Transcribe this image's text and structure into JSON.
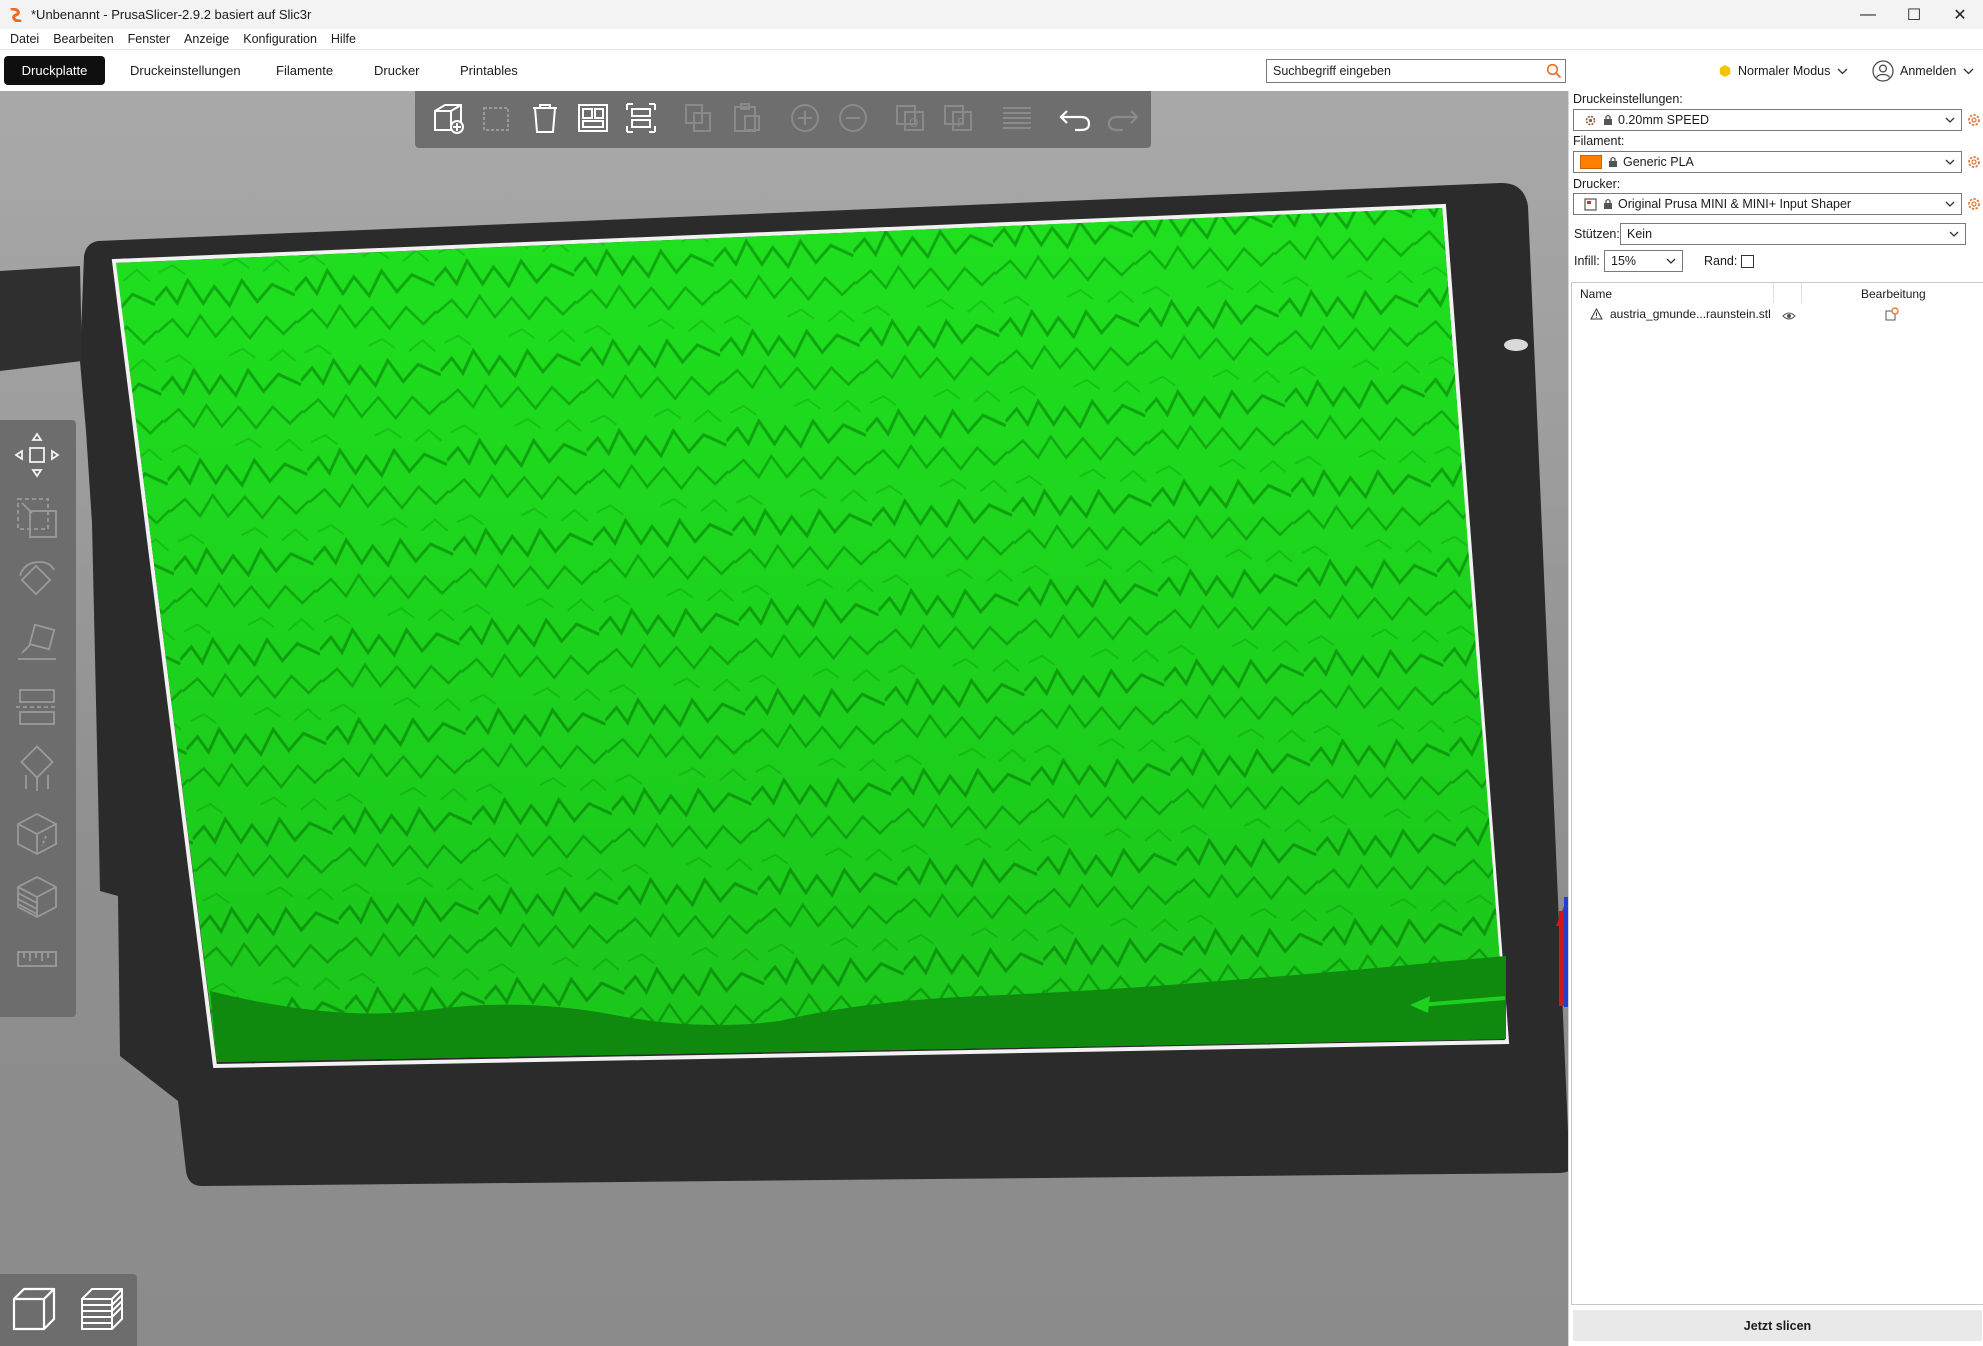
{
  "window": {
    "title": "*Unbenannt - PrusaSlicer-2.9.2 basiert auf Slic3r",
    "minimize": "—",
    "maximize": "☐",
    "close": "✕"
  },
  "menu": [
    "Datei",
    "Bearbeiten",
    "Fenster",
    "Anzeige",
    "Konfiguration",
    "Hilfe"
  ],
  "tabs": {
    "plater": "Druckplatte",
    "print_settings": "Druckeinstellungen",
    "filaments": "Filamente",
    "printer": "Drucker",
    "printables": "Printables"
  },
  "search": {
    "placeholder": "Suchbegriff eingeben"
  },
  "mode": {
    "label": "Normaler Modus",
    "color": "#f5c400"
  },
  "account": {
    "label": "Anmelden"
  },
  "sidebar": {
    "print_settings_label": "Druckeinstellungen:",
    "print_settings_value": "0.20mm SPEED",
    "filament_label": "Filament:",
    "filament_value": "Generic PLA",
    "filament_color": "#ff7f00",
    "printer_label": "Drucker:",
    "printer_value": "Original Prusa MINI & MINI+ Input Shaper",
    "supports_label": "Stützen:",
    "supports_value": "Kein",
    "infill_label": "Infill:",
    "infill_value": "15%",
    "brim_label": "Rand:",
    "brim_checked": false,
    "list_header_name": "Name",
    "list_header_editing": "Bearbeitung",
    "object_name": "austria_gmunde...raunstein.stl",
    "slice_button": "Jetzt slicen"
  },
  "colors": {
    "accent_active_tab": "#0f0f0f",
    "model": "#1fe01f",
    "model_shadow": "#0f8a0f",
    "bed": "#2b2b2b",
    "gear": "#e07a3a"
  }
}
